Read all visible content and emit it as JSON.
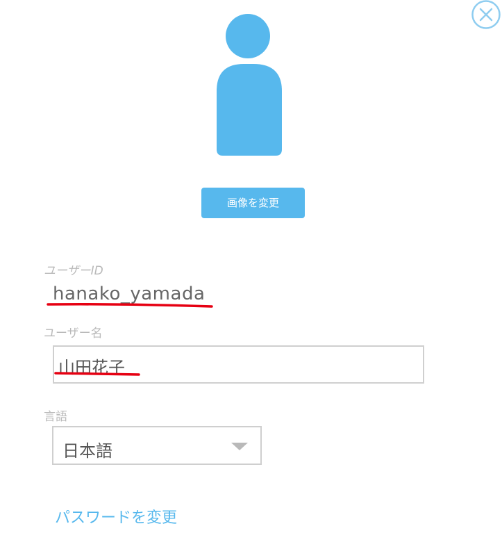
{
  "icons": {
    "close": "close-icon",
    "avatar": "user-avatar-icon",
    "chevron": "chevron-down-icon"
  },
  "colors": {
    "accent": "#57b8ed",
    "annotation": "#e60012",
    "label": "#b9b9b9"
  },
  "profile": {
    "change_image_label": "画像を変更",
    "user_id_label": "ユーザーID",
    "user_id_value": "hanako_yamada",
    "user_name_label": "ユーザー名",
    "user_name_value": "山田花子",
    "language_label": "言語",
    "language_value": "日本語",
    "change_password_label": "パスワードを変更"
  }
}
